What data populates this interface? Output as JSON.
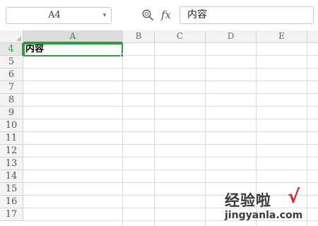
{
  "formula_bar": {
    "name_box": "A4",
    "fx_label": "fx",
    "formula_value": "内容"
  },
  "columns": [
    "A",
    "B",
    "C",
    "D",
    "E"
  ],
  "rows": [
    "4",
    "5",
    "6",
    "7",
    "8",
    "9",
    "10",
    "11",
    "12",
    "13",
    "14",
    "15",
    "16",
    "17"
  ],
  "cells": {
    "A4": "内容"
  },
  "active_cell": "A4",
  "colors": {
    "selection_accent": "#2e9c3c",
    "header_bg": "#f3f3f3",
    "gridline": "#dcdcdc"
  },
  "watermark": {
    "main": "经验啦",
    "check": "√",
    "url": "jingyanla.com"
  }
}
